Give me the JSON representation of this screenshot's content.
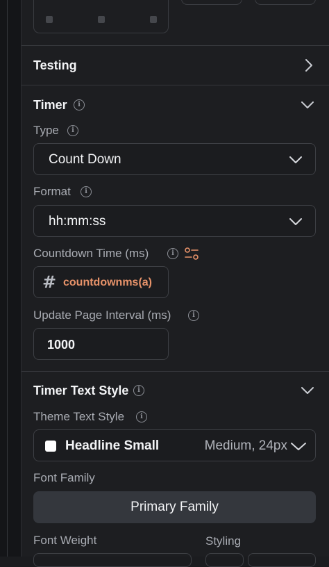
{
  "testing": {
    "title": "Testing"
  },
  "timer": {
    "title": "Timer",
    "type_label": "Type",
    "type_value": "Count Down",
    "format_label": "Format",
    "format_value": "hh:mm:ss",
    "countdown_label": "Countdown Time (ms)",
    "countdown_variable": "countdownms(a)",
    "interval_label": "Update Page Interval (ms)",
    "interval_value": "1000"
  },
  "timer_text_style": {
    "title": "Timer Text Style",
    "theme_label": "Theme Text Style",
    "theme_name": "Headline Small",
    "theme_meta": "Medium, 24px",
    "font_family_label": "Font Family",
    "font_family_value": "Primary Family",
    "font_weight_label": "Font Weight",
    "styling_label": "Styling"
  },
  "icons": {
    "info": "info-icon",
    "chevron_right": "chevron-right-icon",
    "chevron_down": "chevron-down-icon",
    "variable": "hash-icon",
    "sliders": "sliders-icon"
  },
  "colors": {
    "background": "#1d1e21",
    "accent_variable": "#e8936a",
    "field_border": "#3e4045",
    "button_bg": "#34373d"
  }
}
